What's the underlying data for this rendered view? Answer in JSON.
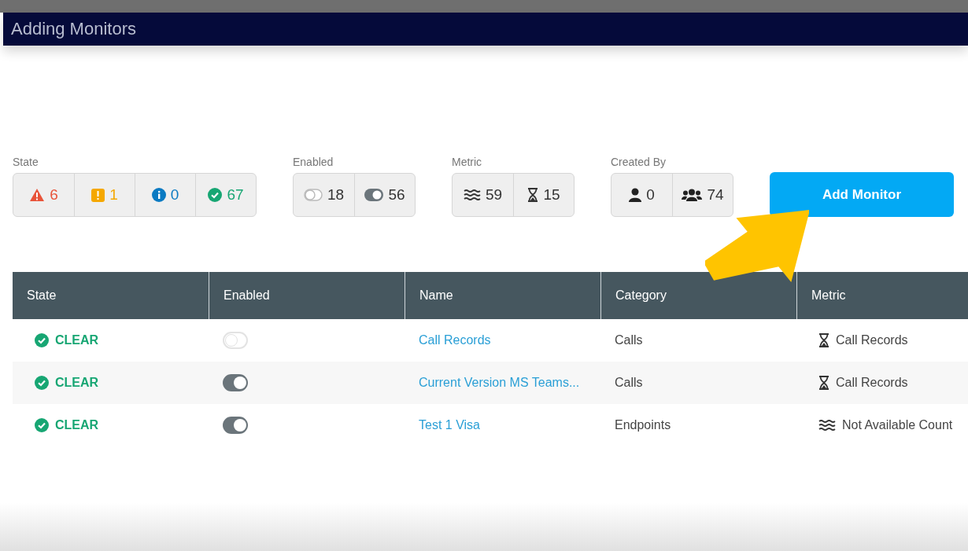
{
  "window": {
    "title": "Adding Monitors"
  },
  "filters": [
    {
      "label": "State",
      "items": [
        {
          "kind": "warning",
          "count": "6",
          "color": "#e8543a"
        },
        {
          "kind": "alert",
          "count": "1",
          "color": "#f5a800"
        },
        {
          "kind": "info",
          "count": "0",
          "color": "#0a7ac2"
        },
        {
          "kind": "ok",
          "count": "67",
          "color": "#17a673"
        }
      ]
    },
    {
      "label": "Enabled",
      "items": [
        {
          "kind": "toggle-off",
          "count": "18",
          "color": "#333333"
        },
        {
          "kind": "toggle-on",
          "count": "56",
          "color": "#333333"
        }
      ]
    },
    {
      "label": "Metric",
      "items": [
        {
          "kind": "wave",
          "count": "59",
          "color": "#333333"
        },
        {
          "kind": "hourglass",
          "count": "15",
          "color": "#333333"
        }
      ]
    },
    {
      "label": "Created By",
      "items": [
        {
          "kind": "user",
          "count": "0",
          "color": "#333333"
        },
        {
          "kind": "users",
          "count": "74",
          "color": "#333333"
        }
      ]
    }
  ],
  "add_button": "Add Monitor",
  "table": {
    "columns": [
      "State",
      "Enabled",
      "Name",
      "Category",
      "Metric"
    ],
    "rows": [
      {
        "state": "CLEAR",
        "enabled": false,
        "name": "Call Records",
        "category": "Calls",
        "metric": {
          "kind": "hourglass",
          "label": "Call Records"
        }
      },
      {
        "state": "CLEAR",
        "enabled": true,
        "name": "Current Version MS Teams...",
        "category": "Calls",
        "metric": {
          "kind": "hourglass",
          "label": "Call Records"
        }
      },
      {
        "state": "CLEAR",
        "enabled": true,
        "name": "Test 1 Visa",
        "category": "Endpoints",
        "metric": {
          "kind": "wave",
          "label": "Not Available Count"
        }
      }
    ]
  }
}
